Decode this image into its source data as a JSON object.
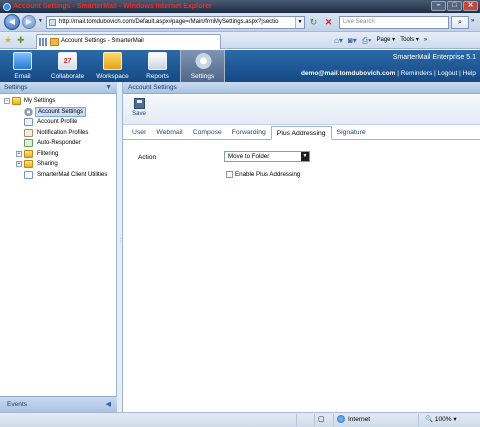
{
  "browser": {
    "window_title": "Account Settings - SmarterMail - Windows Internet Explorer",
    "address": "http://mail.tomdubovich.com/Default.aspx#page=/Main/frmMySettings.aspx?|sectio",
    "search_placeholder": "Live Search",
    "tab_title": "Account Settings - SmarterMail",
    "page_menu": "Page",
    "tools_menu": "Tools",
    "status_zone": "Internet",
    "zoom_level": "100%"
  },
  "app": {
    "nav": [
      {
        "label": "Email",
        "icon": "email-icon"
      },
      {
        "label": "Collaborate",
        "icon": "calendar-icon"
      },
      {
        "label": "Workspace",
        "icon": "workspace-icon"
      },
      {
        "label": "Reports",
        "icon": "reports-icon"
      },
      {
        "label": "Settings",
        "icon": "settings-gear-icon"
      }
    ],
    "brand": "SmarterMail Enterprise 5.1",
    "user_email": "demo@mail.tomdubovich.com",
    "user_links": " | Reminders | Logout | Help"
  },
  "sidebar": {
    "header": "Settings",
    "footer": "Events",
    "tree": [
      {
        "label": "My Settings",
        "level": 0,
        "expander": "−"
      },
      {
        "label": "Account Settings",
        "level": 1,
        "selected": true
      },
      {
        "label": "Account Profile",
        "level": 1
      },
      {
        "label": "Notification Profiles",
        "level": 1
      },
      {
        "label": "Auto-Responder",
        "level": 1
      },
      {
        "label": "Filtering",
        "level": 1,
        "expander": "+"
      },
      {
        "label": "Sharing",
        "level": 1,
        "expander": "+"
      },
      {
        "label": "SmarterMail Client Utilities",
        "level": 1
      }
    ]
  },
  "main": {
    "header": "Account Settings",
    "save_label": "Save",
    "tabs": [
      "User",
      "Webmail",
      "Compose",
      "Forwarding",
      "Plus Addressing",
      "Signature"
    ],
    "active_tab": "Plus Addressing",
    "action_label": "Action",
    "action_value": "Move to Folder",
    "enable_label": "Enable Plus Addressing"
  }
}
